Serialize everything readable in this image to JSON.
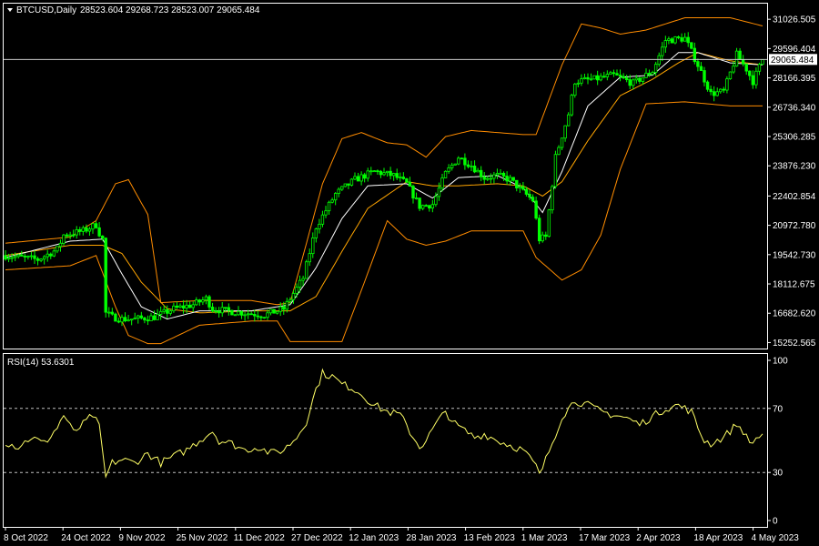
{
  "title": {
    "symbol": "BTCUSD,Daily",
    "ohlc": "28523.604 29268.723 28523.007 29065.484"
  },
  "price_tag": "29065.484",
  "rsi_title": "RSI(14) 53.6301",
  "colors": {
    "background": "#000000",
    "frame": "#ffffff",
    "bull_candle": "#00ff00",
    "bear_candle": "#00ff00",
    "band": "#ff8c00",
    "ma_mid": "#ffa500",
    "ma_fast": "#ffffff",
    "rsi_line": "#ffff66",
    "level_line": "#c0c0c0"
  },
  "chart_data": [
    {
      "type": "candlestick",
      "title": "BTCUSD,Daily",
      "ylim": [
        15050,
        31700
      ],
      "y_ticks": [
        "31026.505",
        "29596.404",
        "28166.395",
        "26736.340",
        "25306.285",
        "23876.230",
        "22402.854",
        "20972.780",
        "19542.730",
        "18112.675",
        "16682.620",
        "15252.565"
      ],
      "y_tick_values": [
        31026.505,
        29596.404,
        28166.395,
        26736.34,
        25306.285,
        23876.23,
        22402.854,
        20972.78,
        19542.73,
        18112.675,
        16682.62,
        15252.565
      ],
      "current_price": 29065.484,
      "x_ticks": [
        "8 Oct 2022",
        "24 Oct 2022",
        "9 Nov 2022",
        "25 Nov 2022",
        "11 Dec 2022",
        "27 Dec 2022",
        "12 Jan 2023",
        "28 Jan 2023",
        "13 Feb 2023",
        "1 Mar 2023",
        "17 Mar 2023",
        "2 Apr 2023",
        "18 Apr 2023",
        "4 May 2023"
      ],
      "close_anchors": [
        [
          0,
          19500
        ],
        [
          10,
          19300
        ],
        [
          16,
          19800
        ],
        [
          18,
          20500
        ],
        [
          24,
          20700
        ],
        [
          28,
          21000
        ],
        [
          29,
          20600
        ],
        [
          30,
          20300
        ],
        [
          31,
          16700
        ],
        [
          33,
          16500
        ],
        [
          36,
          16400
        ],
        [
          40,
          16400
        ],
        [
          46,
          16500
        ],
        [
          52,
          16900
        ],
        [
          58,
          17100
        ],
        [
          62,
          17400
        ],
        [
          64,
          16900
        ],
        [
          68,
          16800
        ],
        [
          74,
          16700
        ],
        [
          80,
          16600
        ],
        [
          86,
          16900
        ],
        [
          92,
          18400
        ],
        [
          96,
          20900
        ],
        [
          102,
          22500
        ],
        [
          108,
          23200
        ],
        [
          114,
          23600
        ],
        [
          120,
          23400
        ],
        [
          124,
          23000
        ],
        [
          128,
          21900
        ],
        [
          132,
          22000
        ],
        [
          136,
          23500
        ],
        [
          140,
          24300
        ],
        [
          144,
          23900
        ],
        [
          148,
          23300
        ],
        [
          152,
          23400
        ],
        [
          156,
          23200
        ],
        [
          160,
          22600
        ],
        [
          163,
          22200
        ],
        [
          165,
          20300
        ],
        [
          167,
          20400
        ],
        [
          170,
          24300
        ],
        [
          174,
          26400
        ],
        [
          176,
          28000
        ],
        [
          182,
          28100
        ],
        [
          188,
          28300
        ],
        [
          194,
          27900
        ],
        [
          200,
          28500
        ],
        [
          204,
          30000
        ],
        [
          210,
          30100
        ],
        [
          214,
          28800
        ],
        [
          218,
          27400
        ],
        [
          222,
          27500
        ],
        [
          226,
          29300
        ],
        [
          229,
          28600
        ],
        [
          231,
          28000
        ],
        [
          234,
          29065
        ]
      ],
      "bollinger_anchors": [
        [
          0,
          20100,
          18800
        ],
        [
          20,
          20400,
          19000
        ],
        [
          28,
          21200,
          19500
        ],
        [
          34,
          23000,
          17000
        ],
        [
          38,
          23200,
          15600
        ],
        [
          44,
          21500,
          15200
        ],
        [
          48,
          17200,
          15200
        ],
        [
          60,
          17300,
          16100
        ],
        [
          76,
          17300,
          16300
        ],
        [
          84,
          17100,
          16300
        ],
        [
          88,
          17200,
          15300
        ],
        [
          92,
          19500,
          15300
        ],
        [
          98,
          23000,
          15300
        ],
        [
          104,
          25200,
          15300
        ],
        [
          110,
          25500,
          17800
        ],
        [
          118,
          25000,
          21200
        ],
        [
          124,
          24900,
          20300
        ],
        [
          130,
          24300,
          20000
        ],
        [
          136,
          25300,
          20200
        ],
        [
          144,
          25600,
          20700
        ],
        [
          160,
          25400,
          20700
        ],
        [
          164,
          25400,
          19400
        ],
        [
          172,
          28800,
          18300
        ],
        [
          178,
          30800,
          18800
        ],
        [
          184,
          30600,
          20500
        ],
        [
          190,
          30300,
          23700
        ],
        [
          198,
          30500,
          26900
        ],
        [
          210,
          31100,
          27000
        ],
        [
          224,
          31100,
          26800
        ],
        [
          234,
          30700,
          26800
        ]
      ],
      "ma_anchors": [
        [
          0,
          19400,
          19500
        ],
        [
          20,
          20200,
          20000
        ],
        [
          30,
          20300,
          20000
        ],
        [
          36,
          18600,
          19600
        ],
        [
          42,
          17000,
          18200
        ],
        [
          50,
          16400,
          16900
        ],
        [
          60,
          16800,
          16700
        ],
        [
          76,
          16800,
          16800
        ],
        [
          88,
          17100,
          16800
        ],
        [
          96,
          18900,
          17500
        ],
        [
          104,
          21300,
          19700
        ],
        [
          112,
          22900,
          21800
        ],
        [
          124,
          23000,
          23100
        ],
        [
          132,
          22300,
          22900
        ],
        [
          140,
          23300,
          22900
        ],
        [
          152,
          23400,
          23000
        ],
        [
          160,
          22800,
          22900
        ],
        [
          166,
          21600,
          22400
        ],
        [
          172,
          23600,
          23100
        ],
        [
          180,
          26800,
          25100
        ],
        [
          190,
          28200,
          27300
        ],
        [
          200,
          28300,
          28100
        ],
        [
          208,
          29400,
          28900
        ],
        [
          214,
          29400,
          29400
        ],
        [
          224,
          28900,
          29000
        ],
        [
          234,
          28800,
          28800
        ]
      ]
    },
    {
      "type": "line",
      "title": "RSI(14) 53.6301",
      "ylim": [
        0,
        100
      ],
      "y_ticks": [
        "100",
        "70",
        "30",
        "0"
      ],
      "y_tick_values": [
        100,
        70,
        30,
        0
      ],
      "levels": [
        70,
        30
      ],
      "rsi_anchors": [
        [
          0,
          49
        ],
        [
          4,
          46
        ],
        [
          8,
          52
        ],
        [
          12,
          48
        ],
        [
          16,
          58
        ],
        [
          18,
          66
        ],
        [
          21,
          55
        ],
        [
          24,
          60
        ],
        [
          27,
          66
        ],
        [
          29,
          58
        ],
        [
          31,
          27
        ],
        [
          33,
          36
        ],
        [
          36,
          38
        ],
        [
          40,
          36
        ],
        [
          44,
          42
        ],
        [
          48,
          36
        ],
        [
          52,
          40
        ],
        [
          56,
          44
        ],
        [
          60,
          50
        ],
        [
          64,
          56
        ],
        [
          66,
          50
        ],
        [
          70,
          48
        ],
        [
          74,
          44
        ],
        [
          78,
          46
        ],
        [
          82,
          42
        ],
        [
          86,
          44
        ],
        [
          90,
          52
        ],
        [
          93,
          62
        ],
        [
          96,
          82
        ],
        [
          98,
          92
        ],
        [
          101,
          90
        ],
        [
          104,
          85
        ],
        [
          107,
          83
        ],
        [
          110,
          79
        ],
        [
          114,
          72
        ],
        [
          118,
          68
        ],
        [
          122,
          66
        ],
        [
          126,
          52
        ],
        [
          128,
          46
        ],
        [
          130,
          50
        ],
        [
          133,
          60
        ],
        [
          136,
          68
        ],
        [
          139,
          60
        ],
        [
          142,
          56
        ],
        [
          145,
          52
        ],
        [
          148,
          54
        ],
        [
          152,
          50
        ],
        [
          156,
          47
        ],
        [
          160,
          44
        ],
        [
          164,
          34
        ],
        [
          165,
          28
        ],
        [
          167,
          38
        ],
        [
          170,
          54
        ],
        [
          172,
          65
        ],
        [
          176,
          75
        ],
        [
          180,
          72
        ],
        [
          184,
          68
        ],
        [
          188,
          66
        ],
        [
          192,
          64
        ],
        [
          196,
          60
        ],
        [
          200,
          65
        ],
        [
          204,
          70
        ],
        [
          208,
          72
        ],
        [
          212,
          68
        ],
        [
          214,
          58
        ],
        [
          216,
          50
        ],
        [
          218,
          48
        ],
        [
          222,
          52
        ],
        [
          226,
          60
        ],
        [
          228,
          56
        ],
        [
          230,
          48
        ],
        [
          234,
          54
        ]
      ]
    }
  ]
}
